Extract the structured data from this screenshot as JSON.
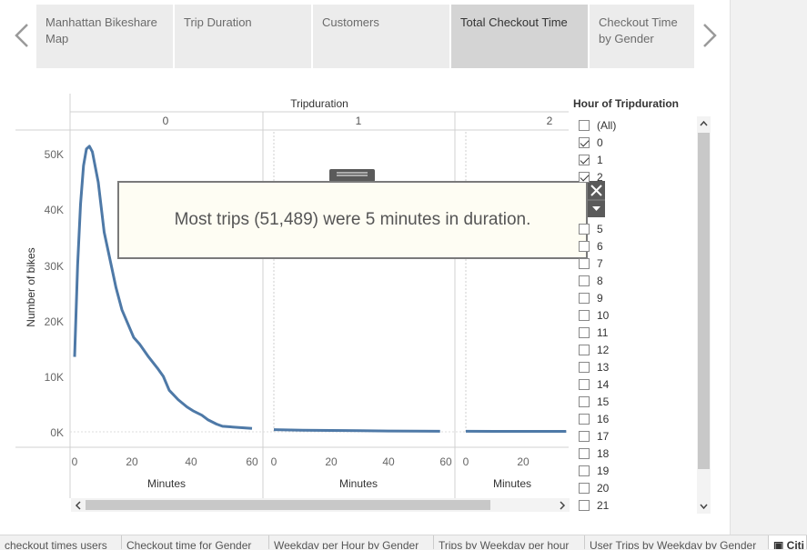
{
  "story": {
    "tabs": [
      {
        "label": "Manhattan Bikeshare Map"
      },
      {
        "label": "Trip Duration"
      },
      {
        "label": "Customers"
      },
      {
        "label": "Total Checkout Time"
      },
      {
        "label": "Checkout Time by Gender"
      }
    ],
    "active_tab": "Total Checkout Time"
  },
  "chart": {
    "column_header": "Tripduration",
    "panes": [
      "0",
      "1",
      "2"
    ],
    "y_axis_label": "Number of bikes",
    "x_axis_label": "Minutes",
    "y_ticks": [
      "50K",
      "40K",
      "30K",
      "20K",
      "10K",
      "0K"
    ],
    "x_ticks_full": [
      "0",
      "20",
      "40",
      "60"
    ],
    "x_ticks_partial": [
      "0",
      "20"
    ]
  },
  "chart_data": {
    "type": "line",
    "title": "Tripduration",
    "xlabel": "Minutes",
    "ylabel": "Number of bikes",
    "ylim": [
      0,
      52000
    ],
    "series": [
      {
        "pane": "0",
        "x": [
          0,
          1,
          2,
          3,
          4,
          5,
          6,
          8,
          10,
          12,
          14,
          16,
          18,
          20,
          22,
          25,
          28,
          30,
          32,
          35,
          38,
          40,
          43,
          45,
          48,
          50,
          55,
          60
        ],
        "values": [
          13500,
          30000,
          41000,
          48000,
          51000,
          51489,
          50500,
          45000,
          36000,
          31000,
          26000,
          22000,
          19500,
          17000,
          15800,
          13500,
          11500,
          10000,
          7500,
          5800,
          4500,
          3800,
          3000,
          2200,
          1400,
          1000,
          800,
          600
        ]
      },
      {
        "pane": "1",
        "x": [
          0,
          10,
          20,
          30,
          40,
          50,
          58
        ],
        "values": [
          400,
          300,
          250,
          200,
          150,
          120,
          100
        ]
      },
      {
        "pane": "2",
        "x": [
          0,
          10,
          20,
          30,
          35
        ],
        "values": [
          100,
          90,
          80,
          80,
          80
        ]
      }
    ],
    "grid": false,
    "legend": "right"
  },
  "annotation": {
    "text": "Most trips (51,489) were 5 minutes in duration."
  },
  "filter": {
    "title": "Hour of Tripduration",
    "items": [
      {
        "label": "(All)",
        "checked": false
      },
      {
        "label": "0",
        "checked": true
      },
      {
        "label": "1",
        "checked": true
      },
      {
        "label": "2",
        "checked": true
      },
      {
        "label": "5",
        "checked": false
      },
      {
        "label": "6",
        "checked": false
      },
      {
        "label": "7",
        "checked": false
      },
      {
        "label": "8",
        "checked": false
      },
      {
        "label": "9",
        "checked": false
      },
      {
        "label": "10",
        "checked": false
      },
      {
        "label": "11",
        "checked": false
      },
      {
        "label": "12",
        "checked": false
      },
      {
        "label": "13",
        "checked": false
      },
      {
        "label": "14",
        "checked": false
      },
      {
        "label": "15",
        "checked": false
      },
      {
        "label": "16",
        "checked": false
      },
      {
        "label": "17",
        "checked": false
      },
      {
        "label": "18",
        "checked": false
      },
      {
        "label": "19",
        "checked": false
      },
      {
        "label": "20",
        "checked": false
      },
      {
        "label": "21",
        "checked": false
      }
    ]
  },
  "sheet_tabs": [
    {
      "label": "checkout times users"
    },
    {
      "label": "Checkout time for Gender"
    },
    {
      "label": "Weekday per Hour by Gender"
    },
    {
      "label": "Trips by Weekday per hour"
    },
    {
      "label": "User Trips by Weekday by Gender"
    },
    {
      "label": "Citi"
    }
  ],
  "colors": {
    "line": "#4e79a7",
    "tab_bg": "#ececec",
    "tab_active": "#d4d4d4",
    "annotation_bg": "#fefdf3"
  },
  "icons": [
    "chevron-left-icon",
    "chevron-right-icon",
    "close-icon",
    "dropdown-arrow-icon",
    "scroll-up-icon",
    "scroll-down-icon",
    "scroll-left-icon",
    "scroll-right-icon",
    "story-icon"
  ]
}
